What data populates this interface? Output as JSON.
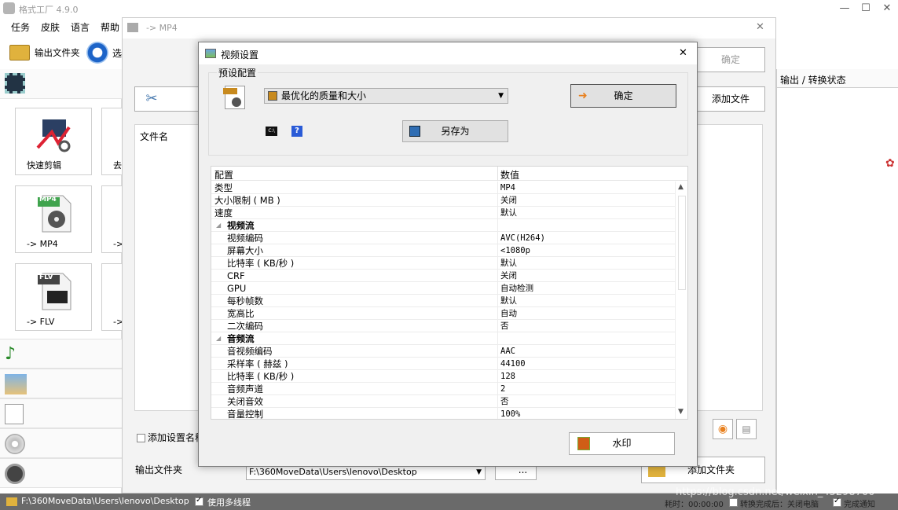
{
  "app": {
    "title": "格式工厂 4.9.0",
    "window_controls": [
      "—",
      "☐",
      "✕"
    ]
  },
  "menu": [
    "任务",
    "皮肤",
    "语言",
    "帮助"
  ],
  "toolbar": {
    "output_folder": "输出文件夹",
    "options_partial": "选"
  },
  "sidebar": {
    "tiles": [
      {
        "label": "快速剪辑",
        "icon": "scissors-film-icon"
      },
      {
        "label": "-> MP4",
        "icon": "mp4-file-icon",
        "badge": "MP4"
      },
      {
        "label": "-> FLV",
        "icon": "flv-file-icon",
        "badge": "FLV"
      }
    ],
    "tiles_col2_partial": [
      "去",
      "->",
      "->"
    ],
    "categories": [
      "music-icon",
      "picture-icon",
      "document-icon",
      "disc-icon",
      "tools-icon"
    ]
  },
  "bgwin": {
    "title": "-> MP4",
    "confirm": "确定",
    "add_file": "添加文件",
    "add_file2": "添加文件夹",
    "file_col": "文件名",
    "add_settings": "添加设置名称",
    "output_folder_label": "输出文件夹",
    "output_path": "F:\\360MoveData\\Users\\lenovo\\Desktop",
    "browse": "..."
  },
  "status_panel": {
    "header": "输出 / 转换状态"
  },
  "statusbar": {
    "path": "F:\\360MoveData\\Users\\lenovo\\Desktop",
    "multithread": "使用多线程",
    "elapsed": "耗时：00:00:00",
    "after_convert": "转换完成后：关闭电脑",
    "notify": "完成通知",
    "watermark_text": "https://blog.csdn.net/weixin_45298700"
  },
  "dialog": {
    "title": "视频设置",
    "preset_label": "预设配置",
    "preset_value": "最优化的质量和大小",
    "ok": "确定",
    "save_as": "另存为",
    "watermark": "水印",
    "table": {
      "col1": "配置",
      "col2": "数值",
      "rows": [
        {
          "k": "类型",
          "v": "MP4",
          "t": "plain"
        },
        {
          "k": "大小限制 ( MB )",
          "v": "关闭",
          "t": "plain"
        },
        {
          "k": "速度",
          "v": "默认",
          "t": "plain"
        },
        {
          "k": "视频流",
          "v": "",
          "t": "sec"
        },
        {
          "k": "视频编码",
          "v": "AVC(H264)",
          "t": "sub"
        },
        {
          "k": "屏幕大小",
          "v": "<1080p",
          "t": "sub"
        },
        {
          "k": "比特率 ( KB/秒 )",
          "v": "默认",
          "t": "sub"
        },
        {
          "k": "CRF",
          "v": "关闭",
          "t": "sub"
        },
        {
          "k": "GPU",
          "v": "自动检测",
          "t": "sub"
        },
        {
          "k": "每秒帧数",
          "v": "默认",
          "t": "sub"
        },
        {
          "k": "宽高比",
          "v": "自动",
          "t": "sub"
        },
        {
          "k": "二次编码",
          "v": "否",
          "t": "sub"
        },
        {
          "k": "音频流",
          "v": "",
          "t": "sec"
        },
        {
          "k": "音视频编码",
          "v": "AAC",
          "t": "sub"
        },
        {
          "k": "采样率 ( 赫兹 )",
          "v": "44100",
          "t": "sub"
        },
        {
          "k": "比特率 ( KB/秒 )",
          "v": "128",
          "t": "sub"
        },
        {
          "k": "音频声道",
          "v": "2",
          "t": "sub"
        },
        {
          "k": "关闭音效",
          "v": "否",
          "t": "sub"
        },
        {
          "k": "音量控制",
          "v": "100%",
          "t": "sub"
        }
      ]
    }
  }
}
